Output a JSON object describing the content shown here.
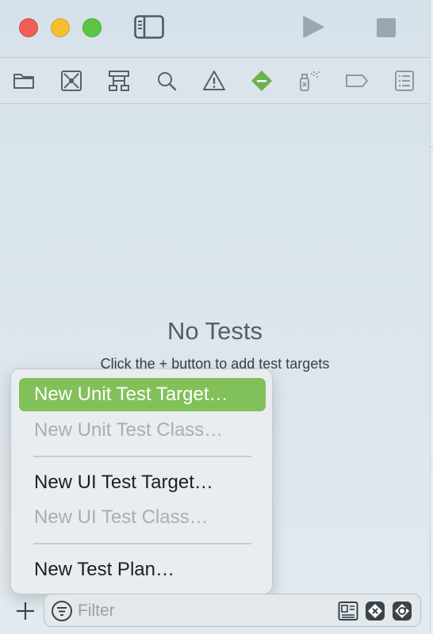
{
  "navigator": {
    "tabs": [
      {
        "icon": "folder-icon",
        "label": "Project navigator"
      },
      {
        "icon": "source-control-icon",
        "label": "Source control navigator"
      },
      {
        "icon": "hierarchy-icon",
        "label": "Symbol navigator"
      },
      {
        "icon": "search-icon",
        "label": "Find navigator"
      },
      {
        "icon": "warning-icon",
        "label": "Issue navigator"
      },
      {
        "icon": "test-diamond-icon",
        "label": "Test navigator",
        "active": true
      },
      {
        "icon": "debug-spray-icon",
        "label": "Debug navigator"
      },
      {
        "icon": "breakpoint-tag-icon",
        "label": "Breakpoint navigator"
      },
      {
        "icon": "report-list-icon",
        "label": "Report navigator"
      }
    ],
    "accent_color": "#6cb34f"
  },
  "empty_state": {
    "title": "No Tests",
    "subtitle": "Click the + button to add test targets"
  },
  "menu": {
    "items": [
      {
        "label": "New Unit Test Target…",
        "state": "highlighted"
      },
      {
        "label": "New Unit Test Class…",
        "state": "disabled"
      },
      {
        "label": "New UI Test Target…",
        "state": "enabled"
      },
      {
        "label": "New UI Test Class…",
        "state": "disabled"
      },
      {
        "label": "New Test Plan…",
        "state": "enabled"
      }
    ],
    "highlight_color": "#82c05a"
  },
  "bottom_bar": {
    "filter_placeholder": "Filter",
    "filter_value": ""
  }
}
